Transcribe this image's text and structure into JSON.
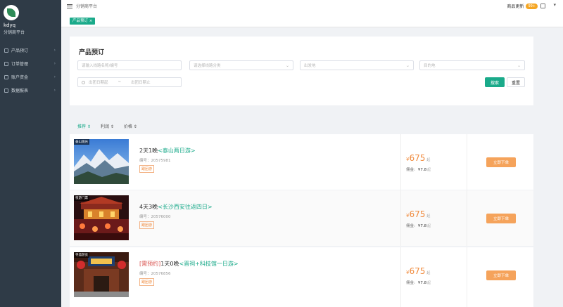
{
  "sidebar": {
    "user": "kdyq",
    "role": "分销商平台",
    "items": [
      {
        "label": "产品预订",
        "icon": "list-icon"
      },
      {
        "label": "订单管理",
        "icon": "order-icon"
      },
      {
        "label": "账户资金",
        "icon": "wallet-icon"
      },
      {
        "label": "数据报表",
        "icon": "chart-icon"
      }
    ]
  },
  "header": {
    "platform": "分销商平台",
    "notice": "商品更新",
    "badge": "99+"
  },
  "tabs": [
    {
      "label": "产品预订"
    }
  ],
  "filter": {
    "title": "产品预订",
    "keyword_placeholder": "请输入线路名称/编号",
    "category_placeholder": "请选择线路分类",
    "departure_placeholder": "出发地",
    "destination_placeholder": "目的地",
    "start_date_placeholder": "出团日期起",
    "date_sep": "~",
    "end_date_placeholder": "出团日期止",
    "search_label": "搜索",
    "reset_label": "重置"
  },
  "sort": [
    {
      "label": "推荐 ⇕",
      "active": true
    },
    {
      "label": "利润 ⇕",
      "active": false
    },
    {
      "label": "价格 ⇕",
      "active": false
    }
  ],
  "products": [
    {
      "tag": "泰山观光",
      "title_prefix": "",
      "title_main": "2天1晚",
      "title_highlight": "<泰山两日游>",
      "code": "编号：20575981",
      "label": "跟团游",
      "currency": "¥",
      "price": "675",
      "price_unit": "起",
      "commission_label": "佣金:",
      "commission": "¥7.8",
      "commission_unit": "起",
      "order_label": "立即下单"
    },
    {
      "tag": "夜游门票",
      "title_prefix": "",
      "title_main": "4天3晚",
      "title_highlight": "<长沙西安往返四日>",
      "code": "编号：20576000",
      "label": "跟团游",
      "currency": "¥",
      "price": "675",
      "price_unit": "起",
      "commission_label": "佣金:",
      "commission": "¥7.8",
      "commission_unit": "起",
      "order_label": "立即下单"
    },
    {
      "tag": "寺庙游览",
      "title_prefix": "[需预约]",
      "title_main": "1天0晚",
      "title_highlight": "<晋祠+科技馆一日游>",
      "code": "编号：20576856",
      "label": "跟团游",
      "currency": "¥",
      "price": "675",
      "price_unit": "起",
      "commission_label": "佣金:",
      "commission": "¥7.8",
      "commission_unit": "起",
      "order_label": "立即下单"
    }
  ],
  "colors": {
    "accent": "#1aaa8a",
    "price": "#f08a3c",
    "sidebar": "#2f3b47"
  }
}
